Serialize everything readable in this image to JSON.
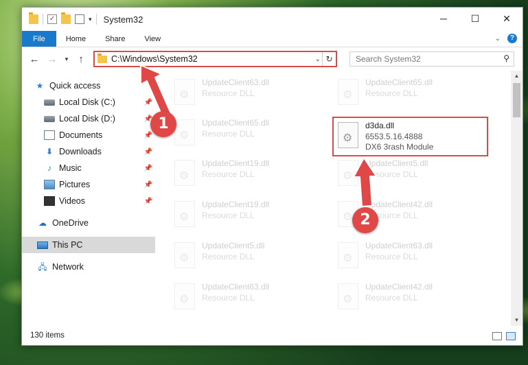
{
  "window": {
    "title": "System32"
  },
  "titlebar": {
    "minimize_icon": "─",
    "maximize_icon": "☐",
    "close_icon": "✕"
  },
  "ribbon": {
    "tabs": [
      {
        "label": "File"
      },
      {
        "label": "Home"
      },
      {
        "label": "Share"
      },
      {
        "label": "View"
      }
    ],
    "help_icon": "?",
    "expand_icon": "⌄"
  },
  "address": {
    "path": "C:\\Windows\\System32",
    "search_placeholder": "Search System32"
  },
  "nav": {
    "items": [
      {
        "label": "Quick access",
        "icon": "star-icon",
        "pinned": false
      },
      {
        "label": "Local Disk (C:)",
        "icon": "drive-icon",
        "pinned": true
      },
      {
        "label": "Local Disk (D:)",
        "icon": "drive-icon",
        "pinned": true
      },
      {
        "label": "Documents",
        "icon": "documents-icon",
        "pinned": true
      },
      {
        "label": "Downloads",
        "icon": "download-icon",
        "pinned": true
      },
      {
        "label": "Music",
        "icon": "music-icon",
        "pinned": true
      },
      {
        "label": "Pictures",
        "icon": "pictures-icon",
        "pinned": true
      },
      {
        "label": "Videos",
        "icon": "videos-icon",
        "pinned": true
      },
      {
        "label": "OneDrive",
        "icon": "onedrive-icon",
        "pinned": false
      },
      {
        "label": "This PC",
        "icon": "this-pc-icon",
        "pinned": false,
        "selected": true
      },
      {
        "label": "Network",
        "icon": "network-icon",
        "pinned": false
      }
    ]
  },
  "files": {
    "left_column": [
      {
        "name": "UpdateClient63.dll",
        "desc": "Resource DLL"
      },
      {
        "name": "UpdateClient65.dll",
        "desc": "Resource DLL"
      },
      {
        "name": "UpdateClient19.dll",
        "desc": "Resource DLL"
      },
      {
        "name": "UpdateClient19.dll",
        "desc": "Resource DLL"
      },
      {
        "name": "UpdateClient5.dll",
        "desc": "Resource DLL"
      },
      {
        "name": "UpdateClient63.dll",
        "desc": "Resource DLL"
      }
    ],
    "right_column": [
      {
        "name": "UpdateClient65.dll",
        "desc": "Resource DLL"
      },
      {
        "name": "d3da.dll",
        "desc": "6553.5.16.4888",
        "desc2": "DX6 3rash Module",
        "highlighted": true
      },
      {
        "name": "UpdateClient5.dll",
        "desc": "Resource DLL"
      },
      {
        "name": "UpdateClient42.dll",
        "desc": "Resource DLL"
      },
      {
        "name": "UpdateClient63.dll",
        "desc": "Resource DLL"
      },
      {
        "name": "UpdateClient42.dll",
        "desc": "Resource DLL"
      }
    ]
  },
  "status": {
    "item_count": "130 items"
  },
  "annotations": {
    "step1": "1",
    "step2": "2",
    "color": "#e04848"
  }
}
